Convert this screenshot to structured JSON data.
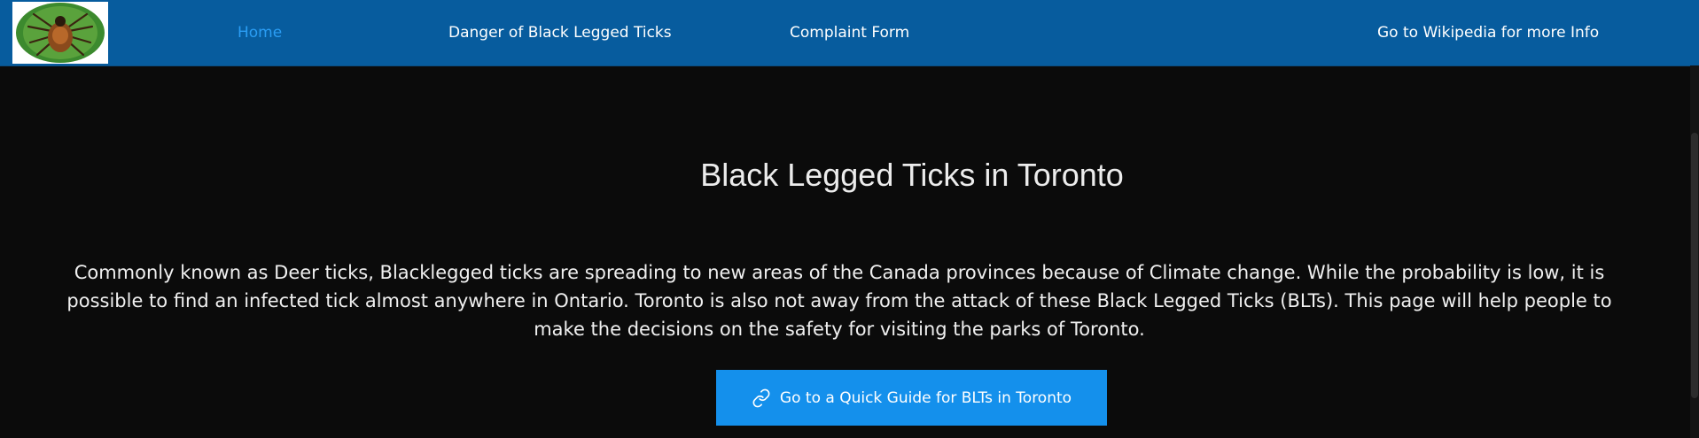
{
  "nav": {
    "logo_alt": "black legged tick logo",
    "links": [
      {
        "label": "Home",
        "active": true
      },
      {
        "label": "Danger of Black Legged Ticks",
        "active": false
      },
      {
        "label": "Complaint Form",
        "active": false
      },
      {
        "label": "Go to Wikipedia for more Info",
        "active": false
      }
    ]
  },
  "hero": {
    "title": "Black Legged Ticks in Toronto",
    "intro": "Commonly known as Deer ticks, Blacklegged ticks are spreading to new areas of the Canada provinces because of Climate change. While the probability is low, it is possible to find an infected tick almost anywhere in Ontario. Toronto is also not away from the attack of these Black Legged Ticks (BLTs). This page will help people to make the decisions on the safety for visiting the parks of Toronto.",
    "button_label": "Go to a Quick Guide for BLTs in Toronto",
    "button_icon": "link-icon"
  },
  "colors": {
    "navbar_bg": "#075c9e",
    "page_bg": "#0b0b0b",
    "active_link": "#2a9df4",
    "button_bg": "#1490ec"
  }
}
